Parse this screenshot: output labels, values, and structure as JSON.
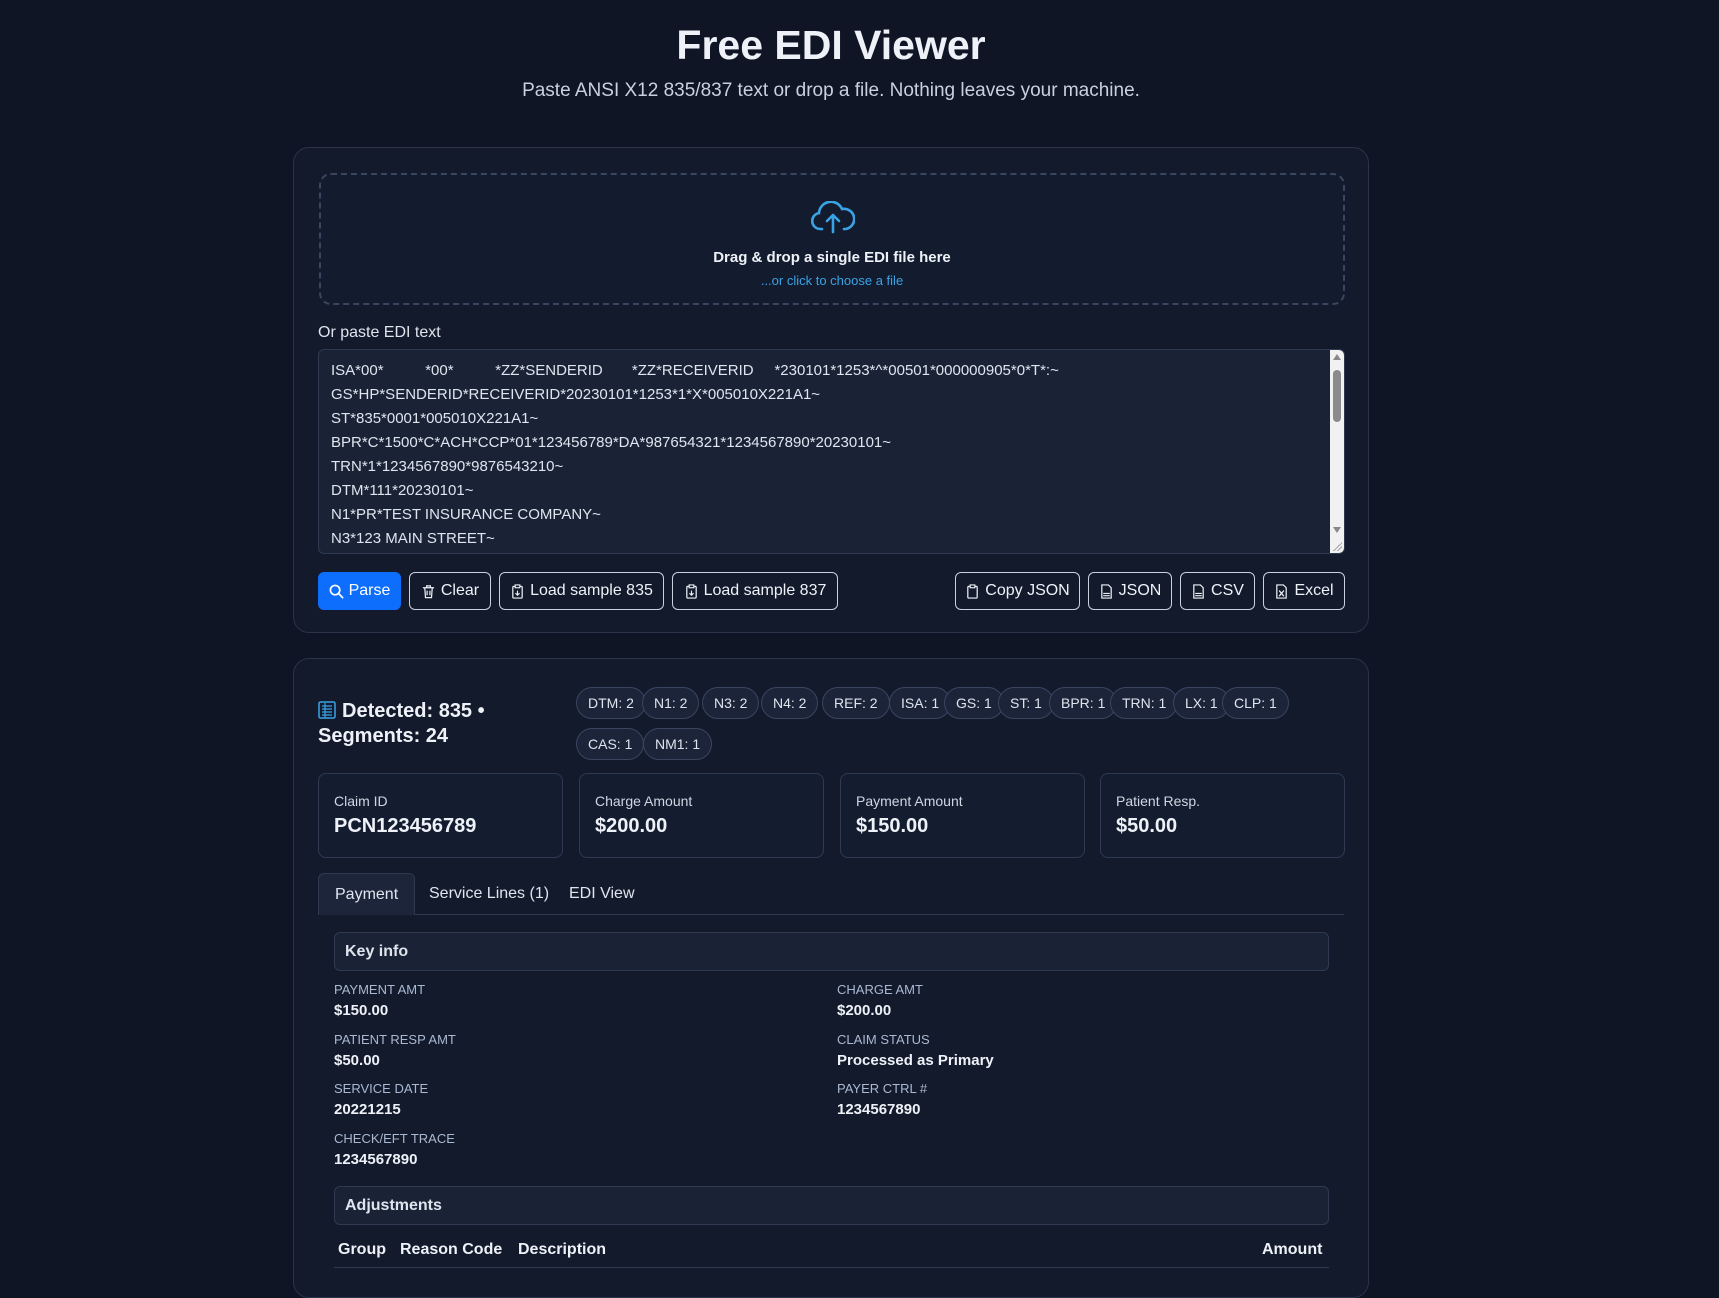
{
  "header": {
    "title": "Free EDI Viewer",
    "subtitle": "Paste ANSI X12 835/837 text or drop a file. Nothing leaves your machine."
  },
  "dropzone": {
    "icon": "cloud-upload-icon",
    "title": "Drag & drop a single EDI file here",
    "link": "...or click to choose a file"
  },
  "paste": {
    "label": "Or paste EDI text",
    "lines": [
      "ISA*00*          *00*          *ZZ*SENDERID       *ZZ*RECEIVERID     *230101*1253*^*00501*000000905*0*T*:~",
      "GS*HP*SENDERID*RECEIVERID*20230101*1253*1*X*005010X221A1~",
      "ST*835*0001*005010X221A1~",
      "BPR*C*1500*C*ACH*CCP*01*123456789*DA*987654321*1234567890*20230101~",
      "TRN*1*1234567890*9876543210~",
      "DTM*111*20230101~",
      "N1*PR*TEST INSURANCE COMPANY~",
      "N3*123 MAIN STREET~"
    ]
  },
  "toolbar": {
    "parse": "Parse",
    "clear": "Clear",
    "load835": "Load sample 835",
    "load837": "Load sample 837",
    "copy_json": "Copy JSON",
    "json": "JSON",
    "csv": "CSV",
    "excel": "Excel"
  },
  "summary": {
    "detected_line1": "Detected: 835 •",
    "detected_line2": "Segments: 24",
    "chips": [
      "DTM: 2",
      "N1: 2",
      "N3: 2",
      "N4: 2",
      "REF: 2",
      "ISA: 1",
      "GS: 1",
      "ST: 1",
      "BPR: 1",
      "TRN: 1",
      "LX: 1",
      "CLP: 1",
      "CAS: 1",
      "NM1: 1"
    ]
  },
  "stats": [
    {
      "label": "Claim ID",
      "value": "PCN123456789"
    },
    {
      "label": "Charge Amount",
      "value": "$200.00"
    },
    {
      "label": "Payment Amount",
      "value": "$150.00"
    },
    {
      "label": "Patient Resp.",
      "value": "$50.00"
    }
  ],
  "tabs": [
    "Payment",
    "Service Lines (1)",
    "EDI View"
  ],
  "key_info": {
    "title": "Key info",
    "items": [
      {
        "label": "PAYMENT AMT",
        "value": "$150.00"
      },
      {
        "label": "CHARGE AMT",
        "value": "$200.00"
      },
      {
        "label": "PATIENT RESP AMT",
        "value": "$50.00"
      },
      {
        "label": "CLAIM STATUS",
        "value": "Processed as Primary"
      },
      {
        "label": "SERVICE DATE",
        "value": "20221215"
      },
      {
        "label": "PAYER CTRL #",
        "value": "1234567890"
      },
      {
        "label": "CHECK/EFT TRACE",
        "value": "1234567890"
      }
    ]
  },
  "adjustments": {
    "title": "Adjustments",
    "columns": [
      "Group",
      "Reason Code",
      "Description",
      "Amount"
    ]
  },
  "colors": {
    "background": "#0f1524",
    "card": "#121a2b",
    "primary": "#0d6efd",
    "accent": "#3aa3e6"
  }
}
